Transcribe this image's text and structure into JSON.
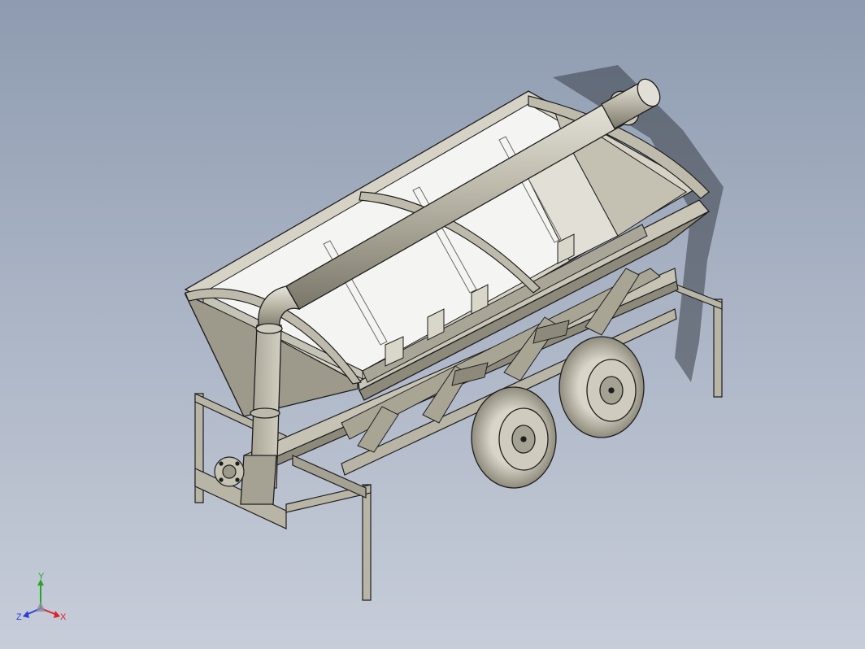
{
  "viewport": {
    "background_top": "#8e9bb0",
    "background_bottom": "#c7cdd9"
  },
  "model": {
    "body_color": "#b9b5a6",
    "body_shade": "#8d897b",
    "interior_color": "#f4f4f2",
    "edge_color": "#1e1e1e",
    "tire_color": "#bdb8a8"
  },
  "triad": {
    "x_label": "X",
    "y_label": "Y",
    "z_label": "Z",
    "x_color": "#d8232a",
    "y_color": "#2aa52a",
    "z_color": "#2b3fd6"
  }
}
